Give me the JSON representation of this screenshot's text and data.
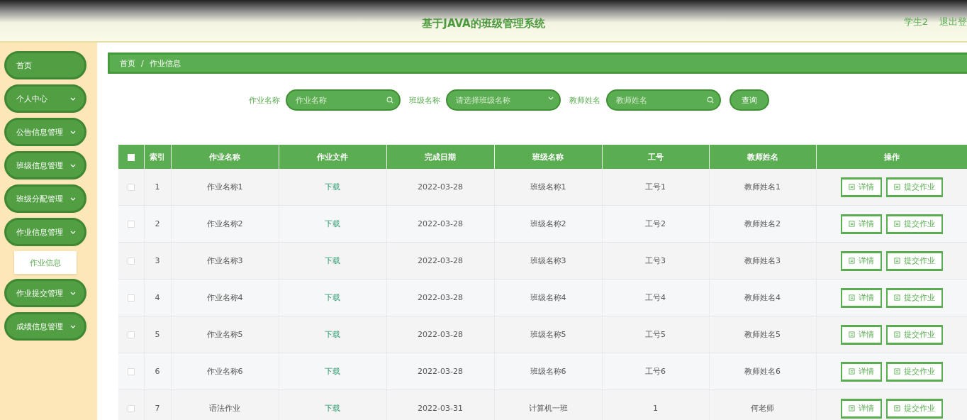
{
  "header": {
    "title": "基于JAVA的班级管理系统",
    "user": "学生2",
    "logout": "退出登"
  },
  "sidebar": {
    "items": [
      {
        "label": "首页",
        "kind": "link"
      },
      {
        "label": "个人中心",
        "kind": "menu"
      },
      {
        "label": "公告信息管理",
        "kind": "menu"
      },
      {
        "label": "班级信息管理",
        "kind": "menu"
      },
      {
        "label": "班级分配管理",
        "kind": "menu"
      },
      {
        "label": "作业信息管理",
        "kind": "menu",
        "children": [
          {
            "label": "作业信息",
            "selected": true
          }
        ]
      },
      {
        "label": "作业提交管理",
        "kind": "menu"
      },
      {
        "label": "成绩信息管理",
        "kind": "menu"
      }
    ]
  },
  "breadcrumb": [
    "首页",
    "作业信息"
  ],
  "breadcrumb_separator": "/",
  "search": {
    "fields": [
      {
        "label": "作业名称",
        "kind": "text",
        "placeholder": "作业名称"
      },
      {
        "label": "班级名称",
        "kind": "select",
        "placeholder": "请选择班级名称"
      },
      {
        "label": "教师姓名",
        "kind": "text",
        "placeholder": "教师姓名"
      }
    ],
    "button": "查询"
  },
  "table": {
    "select_all": {
      "checked": false
    },
    "columns": [
      "索引",
      "作业名称",
      "作业文件",
      "完成日期",
      "班级名称",
      "工号",
      "教师姓名",
      "操作"
    ],
    "rows": [
      {
        "checked": false,
        "cells": [
          "1",
          "作业名称1",
          "下载",
          "2022-03-28",
          "班级名称1",
          "工号1",
          "教师姓名1"
        ],
        "actions": [
          "详情",
          "提交作业"
        ]
      },
      {
        "checked": false,
        "cells": [
          "2",
          "作业名称2",
          "下载",
          "2022-03-28",
          "班级名称2",
          "工号2",
          "教师姓名2"
        ],
        "actions": [
          "详情",
          "提交作业"
        ]
      },
      {
        "checked": false,
        "cells": [
          "3",
          "作业名称3",
          "下载",
          "2022-03-28",
          "班级名称3",
          "工号3",
          "教师姓名3"
        ],
        "actions": [
          "详情",
          "提交作业"
        ]
      },
      {
        "checked": false,
        "cells": [
          "4",
          "作业名称4",
          "下载",
          "2022-03-28",
          "班级名称4",
          "工号4",
          "教师姓名4"
        ],
        "actions": [
          "详情",
          "提交作业"
        ]
      },
      {
        "checked": false,
        "cells": [
          "5",
          "作业名称5",
          "下载",
          "2022-03-28",
          "班级名称5",
          "工号5",
          "教师姓名5"
        ],
        "actions": [
          "详情",
          "提交作业"
        ]
      },
      {
        "checked": false,
        "cells": [
          "6",
          "作业名称6",
          "下载",
          "2022-03-28",
          "班级名称6",
          "工号6",
          "教师姓名6"
        ],
        "actions": [
          "详情",
          "提交作业"
        ]
      },
      {
        "checked": false,
        "cells": [
          "7",
          "语法作业",
          "下载",
          "2022-03-31",
          "计算机一班",
          "1",
          "何老师"
        ],
        "actions": [
          "详情",
          "提交作业"
        ]
      }
    ]
  }
}
